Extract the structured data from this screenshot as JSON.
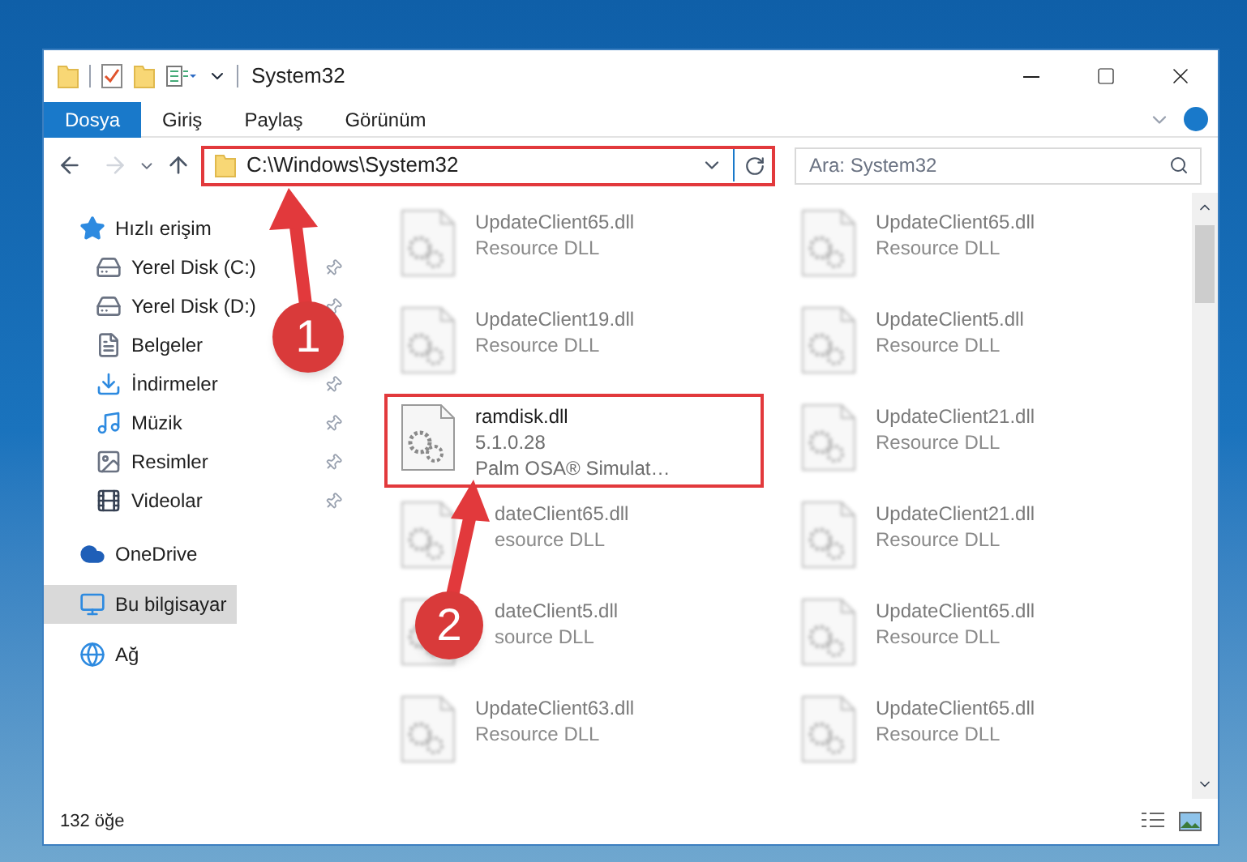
{
  "window": {
    "title": "System32"
  },
  "ribbon_tabs": [
    {
      "label": "Dosya",
      "selected": true
    },
    {
      "label": "Giriş",
      "selected": false
    },
    {
      "label": "Paylaş",
      "selected": false
    },
    {
      "label": "Görünüm",
      "selected": false
    }
  ],
  "address": {
    "path": "C:\\Windows\\System32",
    "highlighted": true
  },
  "search": {
    "placeholder": "Ara: System32"
  },
  "sidebar": {
    "items": [
      {
        "label": "Hızlı erişim",
        "selected": false,
        "children": [
          {
            "label": "Yerel Disk (C:)",
            "selected": false,
            "pinned": true
          },
          {
            "label": "Yerel Disk (D:)",
            "selected": false,
            "pinned": true
          },
          {
            "label": "Belgeler",
            "selected": false
          },
          {
            "label": "İndirmeler",
            "selected": false,
            "pinned": true
          },
          {
            "label": "Müzik",
            "selected": false,
            "pinned": true
          },
          {
            "label": "Resimler",
            "selected": false,
            "pinned": true
          },
          {
            "label": "Videolar",
            "selected": false,
            "pinned": true
          }
        ]
      },
      {
        "label": "OneDrive",
        "selected": false
      },
      {
        "label": "Bu bilgisayar",
        "selected": true
      },
      {
        "label": "Ağ",
        "selected": false
      }
    ]
  },
  "files": [
    {
      "name": "UpdateClient65.dll",
      "details": [
        "Resource DLL"
      ],
      "blurred": true,
      "highlighted": false
    },
    {
      "name": "UpdateClient65.dll",
      "details": [
        "Resource DLL"
      ],
      "blurred": true,
      "highlighted": false
    },
    {
      "name": "UpdateClient19.dll",
      "details": [
        "Resource DLL"
      ],
      "blurred": true,
      "highlighted": false
    },
    {
      "name": "UpdateClient5.dll",
      "details": [
        "Resource DLL"
      ],
      "blurred": true,
      "highlighted": false
    },
    {
      "name": "ramdisk.dll",
      "details": [
        "5.1.0.28",
        "Palm OSA® Simulat…"
      ],
      "blurred": false,
      "highlighted": true
    },
    {
      "name": "UpdateClient21.dll",
      "details": [
        "Resource DLL"
      ],
      "blurred": true,
      "highlighted": false
    },
    {
      "name": "dateClient65.dll",
      "details": [
        "esource DLL"
      ],
      "blurred": true,
      "highlighted": false,
      "kind": "covered"
    },
    {
      "name": "UpdateClient21.dll",
      "details": [
        "Resource DLL"
      ],
      "blurred": true,
      "highlighted": false
    },
    {
      "name": "dateClient5.dll",
      "details": [
        "source DLL"
      ],
      "blurred": true,
      "highlighted": false,
      "kind": "covered"
    },
    {
      "name": "UpdateClient65.dll",
      "details": [
        "Resource DLL"
      ],
      "blurred": true,
      "highlighted": false
    },
    {
      "name": "UpdateClient63.dll",
      "details": [
        "Resource DLL"
      ],
      "blurred": true,
      "highlighted": false
    },
    {
      "name": "UpdateClient65.dll",
      "details": [
        "Resource DLL"
      ],
      "blurred": true,
      "highlighted": false
    }
  ],
  "status_bar": {
    "count": "132 öğe"
  },
  "annotations": [
    {
      "label": "1"
    },
    {
      "label": "2"
    }
  ]
}
